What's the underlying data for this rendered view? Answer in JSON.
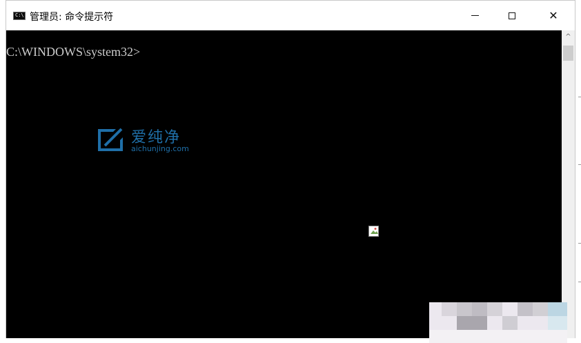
{
  "window": {
    "title": "管理员: 命令提示符",
    "app_icon_text": "C:\\",
    "buttons": {
      "minimize": "minimize",
      "maximize": "maximize",
      "close": "✕"
    }
  },
  "console": {
    "prompt": "C:\\WINDOWS\\system32>"
  },
  "watermark": {
    "name_cn": "爱纯净",
    "name_en": "aichunjing.com"
  },
  "scrollbar": {
    "up_arrow": "^"
  },
  "colors": {
    "console_bg": "#000000",
    "console_text": "#cccccc",
    "watermark": "#1f6fa8",
    "scrollbar_bg": "#f0f0f0",
    "scroll_thumb": "#cdcdcd"
  }
}
